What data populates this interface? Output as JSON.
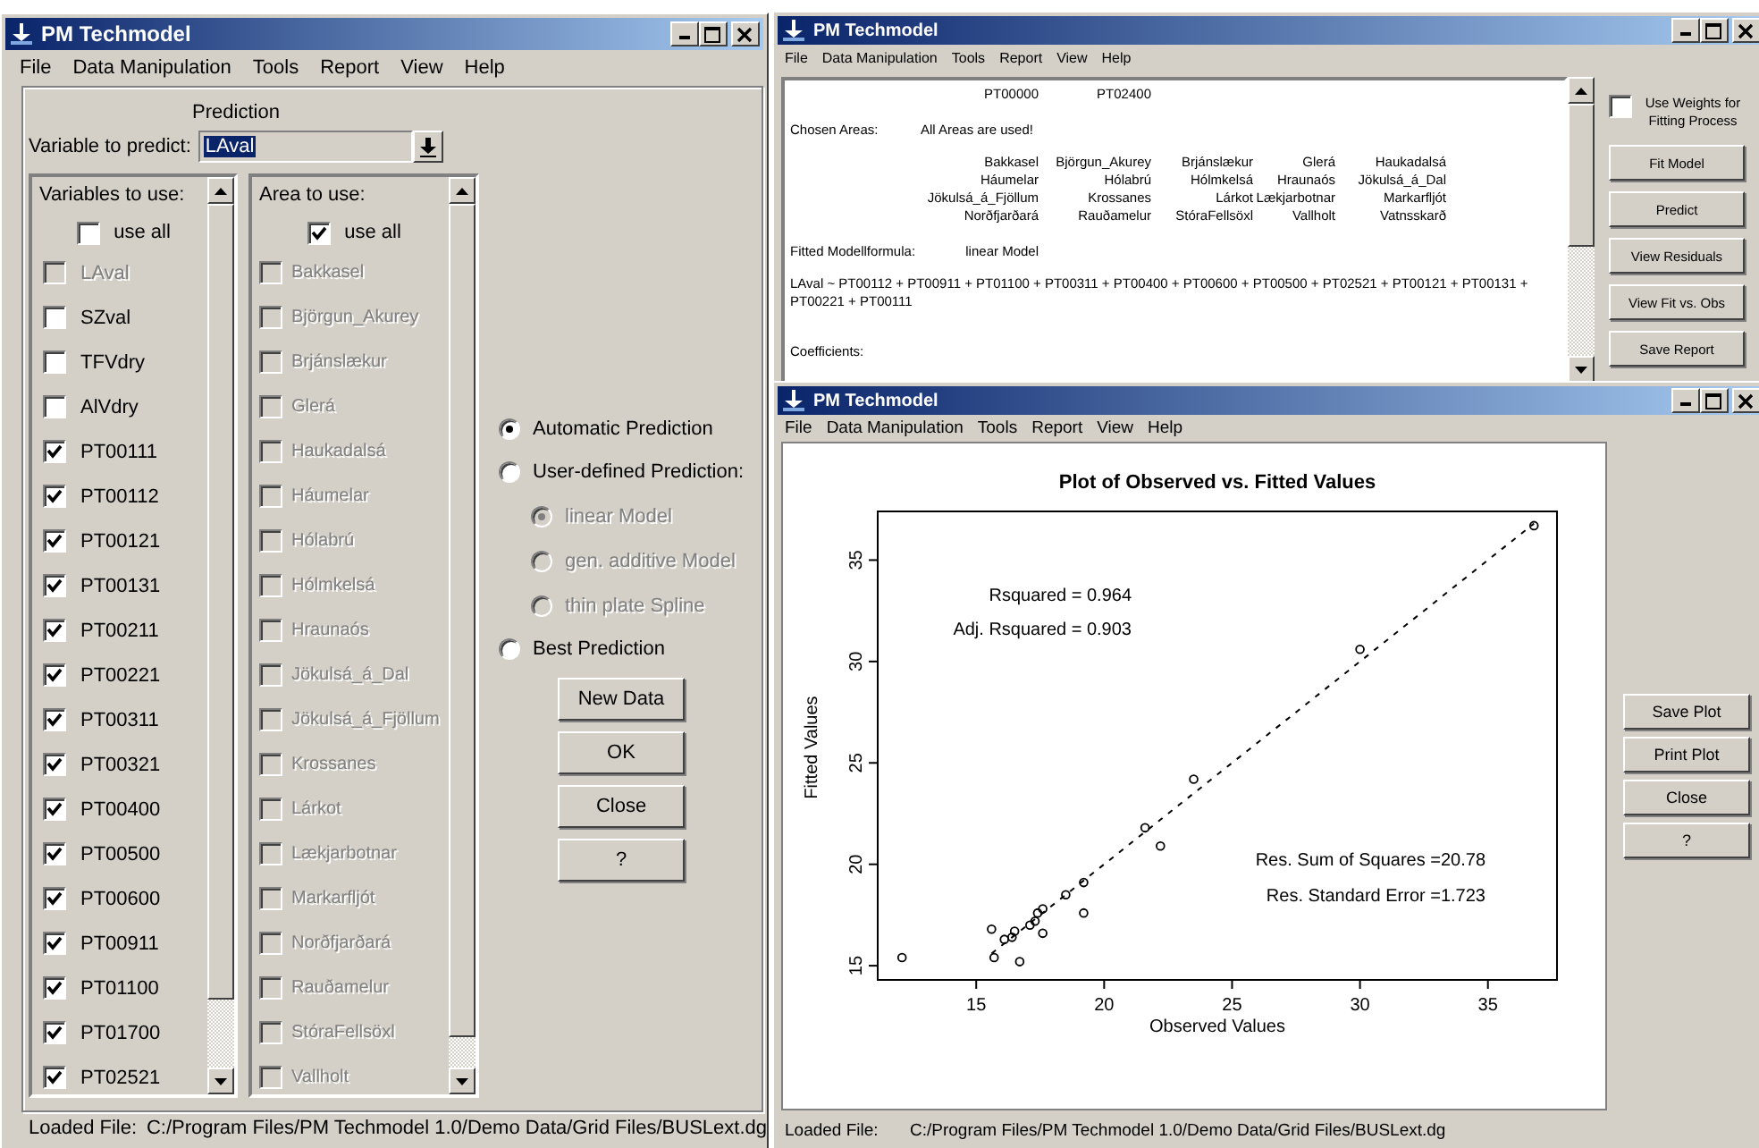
{
  "prediction_window": {
    "title": "PM Techmodel",
    "menu": [
      "File",
      "Data Manipulation",
      "Tools",
      "Report",
      "View",
      "Help"
    ],
    "heading": "Prediction",
    "variable_to_predict": {
      "label": "Variable to predict:",
      "value": "LAval",
      "highlighted": true
    },
    "variables": {
      "label": "Variables to use:",
      "use_all": {
        "label": "use all",
        "checked": false
      },
      "items": [
        {
          "label": "LAval",
          "checked": false,
          "disabled": true
        },
        {
          "label": "SZval",
          "checked": false,
          "disabled": false
        },
        {
          "label": "TFVdry",
          "checked": false,
          "disabled": false
        },
        {
          "label": "AlVdry",
          "checked": false,
          "disabled": false
        },
        {
          "label": "PT00111",
          "checked": true,
          "disabled": false
        },
        {
          "label": "PT00112",
          "checked": true,
          "disabled": false
        },
        {
          "label": "PT00121",
          "checked": true,
          "disabled": false
        },
        {
          "label": "PT00131",
          "checked": true,
          "disabled": false
        },
        {
          "label": "PT00211",
          "checked": true,
          "disabled": false
        },
        {
          "label": "PT00221",
          "checked": true,
          "disabled": false
        },
        {
          "label": "PT00311",
          "checked": true,
          "disabled": false
        },
        {
          "label": "PT00321",
          "checked": true,
          "disabled": false
        },
        {
          "label": "PT00400",
          "checked": true,
          "disabled": false
        },
        {
          "label": "PT00500",
          "checked": true,
          "disabled": false
        },
        {
          "label": "PT00600",
          "checked": true,
          "disabled": false
        },
        {
          "label": "PT00911",
          "checked": true,
          "disabled": false
        },
        {
          "label": "PT01100",
          "checked": true,
          "disabled": false
        },
        {
          "label": "PT01700",
          "checked": true,
          "disabled": false
        },
        {
          "label": "PT02521",
          "checked": true,
          "disabled": false
        }
      ]
    },
    "areas": {
      "label": "Area to use:",
      "use_all": {
        "label": "use all",
        "checked": true
      },
      "items": [
        {
          "label": "Bakkasel",
          "checked": false,
          "disabled": true
        },
        {
          "label": "Björgun_Akurey",
          "checked": false,
          "disabled": true
        },
        {
          "label": "Brjánslækur",
          "checked": false,
          "disabled": true
        },
        {
          "label": "Glerá",
          "checked": false,
          "disabled": true
        },
        {
          "label": "Haukadalsá",
          "checked": false,
          "disabled": true
        },
        {
          "label": "Háumelar",
          "checked": false,
          "disabled": true
        },
        {
          "label": "Hólabrú",
          "checked": false,
          "disabled": true
        },
        {
          "label": "Hólmkelsá",
          "checked": false,
          "disabled": true
        },
        {
          "label": "Hraunaós",
          "checked": false,
          "disabled": true
        },
        {
          "label": "Jökulsá_á_Dal",
          "checked": false,
          "disabled": true
        },
        {
          "label": "Jökulsá_á_Fjöllum",
          "checked": false,
          "disabled": true
        },
        {
          "label": "Krossanes",
          "checked": false,
          "disabled": true
        },
        {
          "label": "Lárkot",
          "checked": false,
          "disabled": true
        },
        {
          "label": "Lækjarbotnar",
          "checked": false,
          "disabled": true
        },
        {
          "label": "Markarfljót",
          "checked": false,
          "disabled": true
        },
        {
          "label": "Norðfjarðará",
          "checked": false,
          "disabled": true
        },
        {
          "label": "Rauðamelur",
          "checked": false,
          "disabled": true
        },
        {
          "label": "StóraFellsöxl",
          "checked": false,
          "disabled": true
        },
        {
          "label": "Vallholt",
          "checked": false,
          "disabled": true
        }
      ]
    },
    "prediction_modes": [
      {
        "label": "Automatic Prediction",
        "selected": true,
        "disabled": false
      },
      {
        "label": "User-defined Prediction:",
        "selected": false,
        "disabled": false,
        "children": [
          {
            "label": "linear Model",
            "selected": true,
            "disabled": true
          },
          {
            "label": "gen. additive Model",
            "selected": false,
            "disabled": true
          },
          {
            "label": "thin plate Spline",
            "selected": false,
            "disabled": true
          }
        ]
      },
      {
        "label": "Best Prediction",
        "selected": false,
        "disabled": false
      }
    ],
    "buttons": [
      "New Data",
      "OK",
      "Close",
      "?"
    ],
    "status_bar": {
      "label": "Loaded File:",
      "value": "C:/Program Files/PM Techmodel 1.0/Demo Data/Grid Files/BUSLext.dg"
    }
  },
  "report_window": {
    "title": "PM Techmodel",
    "menu": [
      "File",
      "Data Manipulation",
      "Tools",
      "Report",
      "View",
      "Help"
    ],
    "report": {
      "variables": [
        "PT00000",
        "PT02400"
      ],
      "chosen_areas": {
        "label": "Chosen Areas:",
        "value": "All Areas are used!"
      },
      "areas": [
        "Bakkasel",
        "Björgun_Akurey",
        "Brjánslækur",
        "Glerá",
        "Haukadalsá",
        "Háumelar",
        "Hólabrú",
        "Hólmkelsá",
        "Hraunaós",
        "Jökulsá_á_Dal",
        "Jökulsá_á_Fjöllum",
        "Krossanes",
        "Lárkot",
        "Lækjarbotnar",
        "Markarfljót",
        "Norðfjarðará",
        "Rauðamelur",
        "StóraFellsöxl",
        "Vallholt",
        "Vatnsskarð"
      ],
      "formula": {
        "label": "Fitted Modellformula:",
        "value": "linear Model"
      },
      "formula_text": "LAval ~ PT00112 + PT00911 + PT01100 + PT00311 + PT00400 + PT00600 + PT00500 + PT02521 + PT00121 + PT00131 + PT00221 + PT00111",
      "coefficients_label": "Coefficients:"
    },
    "use_weights": {
      "label": "Use Weights for Fitting Process",
      "checked": false
    },
    "buttons": [
      "Fit Model",
      "Predict",
      "View Residuals",
      "View Fit vs. Obs",
      "Save Report"
    ]
  },
  "plot_window": {
    "title": "PM Techmodel",
    "menu": [
      "File",
      "Data Manipulation",
      "Tools",
      "Report",
      "View",
      "Help"
    ],
    "chart_data": {
      "type": "scatter",
      "title": "Plot of Observed vs. Fitted Values",
      "xlabel": "Observed Values",
      "ylabel": "Fitted Values",
      "x": [
        12.1,
        15.6,
        15.7,
        16.1,
        16.4,
        16.5,
        16.7,
        17.1,
        17.3,
        17.4,
        17.6,
        17.6,
        18.5,
        19.2,
        19.2,
        21.6,
        22.2,
        23.5,
        30.0,
        36.8
      ],
      "series": [
        {
          "color": "#000000",
          "values": [
            15.4,
            16.8,
            15.4,
            16.3,
            16.4,
            16.7,
            15.2,
            17.0,
            17.2,
            17.6,
            17.8,
            16.6,
            18.5,
            19.1,
            17.6,
            21.8,
            20.9,
            24.2,
            30.6,
            36.7
          ]
        },
        {
          "type": "line",
          "line_style": "dashed",
          "color": "#000000",
          "values": [
            null,
            15.6,
            15.7,
            16.1,
            16.4,
            16.5,
            16.7,
            17.1,
            17.3,
            17.4,
            17.6,
            17.6,
            18.5,
            19.2,
            19.2,
            21.6,
            22.2,
            23.5,
            30.0,
            36.8
          ]
        }
      ],
      "xlim": [
        11.15,
        37.7
      ],
      "ylim": [
        14.3,
        37.4
      ],
      "xticks": [
        15,
        20,
        25,
        30,
        35
      ],
      "yticks": [
        15,
        20,
        25,
        30,
        35
      ],
      "annotations": [
        "Rsquared =  0.964",
        "Adj. Rsquared =  0.903",
        "Res. Sum of Squares  =20.78",
        "Res. Standard Error  =1.723"
      ]
    },
    "buttons": [
      "Save Plot",
      "Print Plot",
      "Close",
      "?"
    ],
    "status_bar": {
      "label": "Loaded File:",
      "value": "C:/Program Files/PM Techmodel 1.0/Demo Data/Grid Files/BUSLext.dg"
    }
  }
}
